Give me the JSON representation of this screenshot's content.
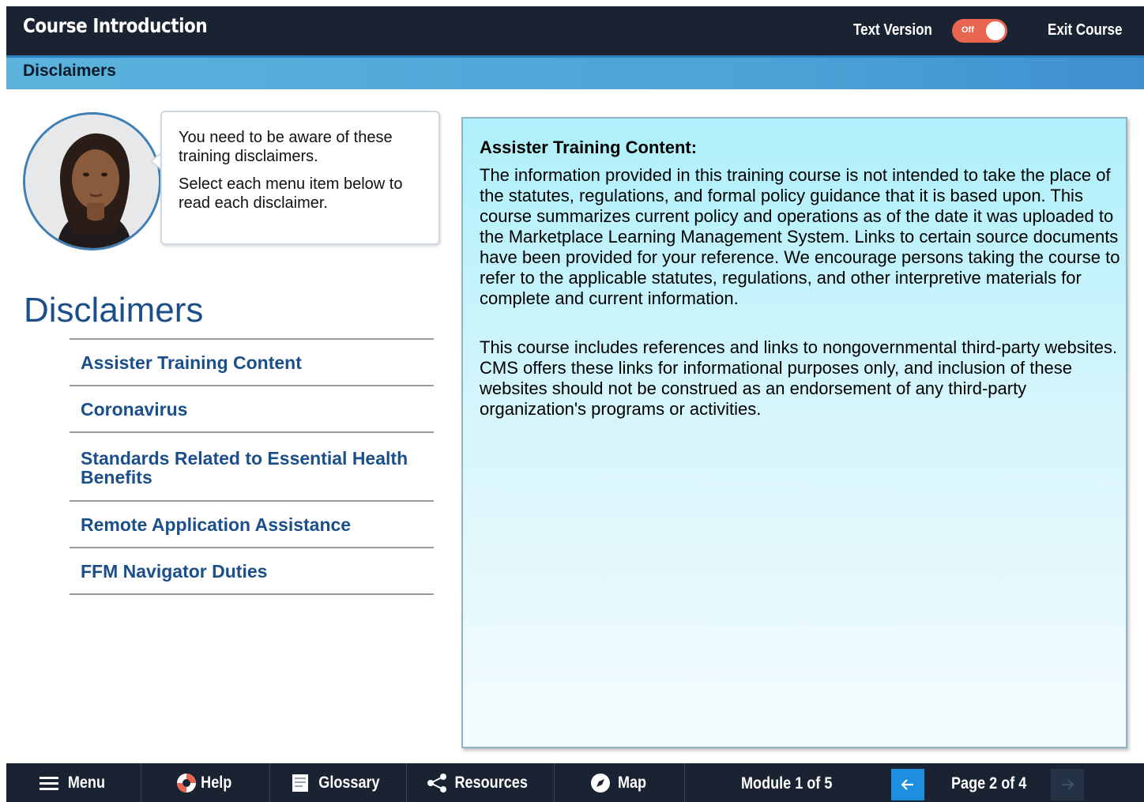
{
  "header": {
    "title": "Course Introduction",
    "text_version_label": "Text Version",
    "toggle_state": "Off",
    "exit_label": "Exit Course"
  },
  "section": {
    "title": "Disclaimers"
  },
  "narrator": {
    "line1": "You need to be aware of these training disclaimers.",
    "line2": "Select each menu item below to read each disclaimer."
  },
  "disclaimers": {
    "heading": "Disclaimers",
    "items": [
      {
        "label": "Assister Training Content"
      },
      {
        "label": "Coronavirus"
      },
      {
        "label": "Standards Related to Essential Health Benefits"
      },
      {
        "label": "Remote Application Assistance"
      },
      {
        "label": "FFM Navigator Duties"
      }
    ]
  },
  "panel": {
    "title": "Assister Training Content:",
    "paragraph1": "The information provided in this training course is not intended to take the place of the statutes, regulations, and formal policy guidance that it is based upon. This course summarizes current policy and operations as of the date it was uploaded to the Marketplace Learning Management System. Links to certain source documents have been provided for your reference. We encourage persons taking the course to refer to the applicable statutes, regulations, and other interpretive materials for complete and current information.",
    "paragraph2": "This course includes references and links to nongovernmental third-party websites. CMS offers these links for informational purposes only, and inclusion of these websites should not be construed as an endorsement of any third-party organization's programs or activities."
  },
  "footer": {
    "menu": "Menu",
    "help": "Help",
    "glossary": "Glossary",
    "resources": "Resources",
    "map": "Map",
    "module": "Module 1 of 5",
    "page": "Page 2 of 4"
  },
  "colors": {
    "bar_dark": "#1a2332",
    "accent_blue": "#1b4f8a",
    "toggle_off": "#e8664f",
    "nav_active": "#1d8ee0"
  }
}
